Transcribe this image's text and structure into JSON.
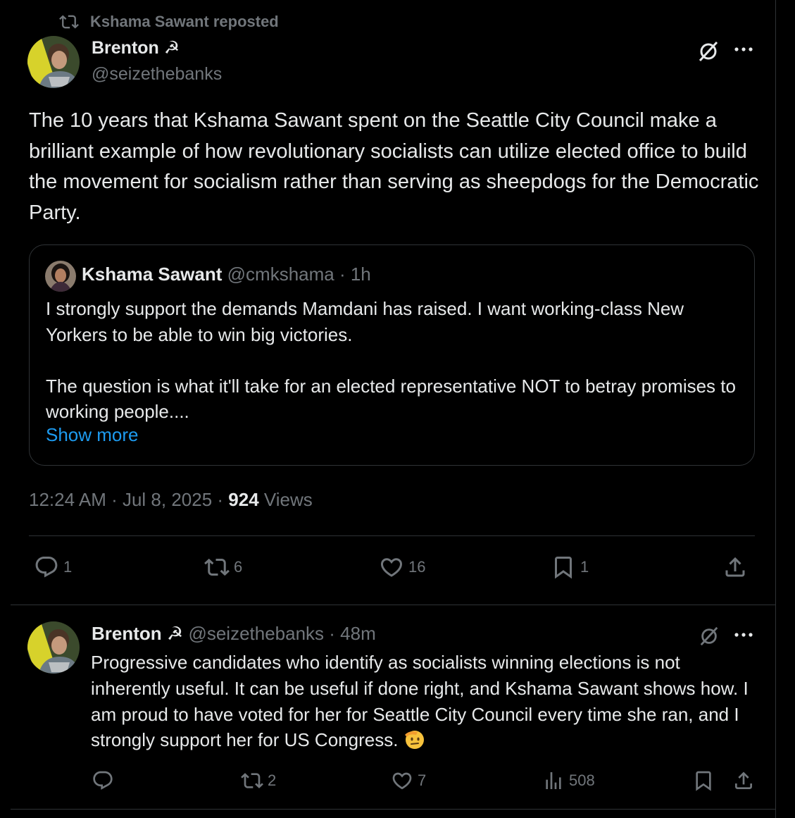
{
  "repost_banner": {
    "text": "Kshama Sawant reposted"
  },
  "main_post": {
    "author_name": "Brenton ☭",
    "author_handle": "@seizethebanks",
    "body": "The 10 years that Kshama Sawant spent on the Seattle City Council make a brilliant example of how revolutionary socialists can utilize elected office to build the movement for socialism rather than serving as sheepdogs for the Democratic Party.",
    "quote": {
      "author_name": "Kshama Sawant",
      "author_handle": "@cmkshama",
      "time": "· 1h",
      "para1": "I strongly support the demands Mamdani has raised. I want working-class New Yorkers to be able to win big victories.",
      "para2": "The question is what it'll take for an elected representative NOT to betray promises to working people....",
      "show_more": "Show more"
    },
    "timestamp": "12:24 AM · Jul 8, 2025 · ",
    "views_count": "924",
    "views_label": " Views",
    "actions": {
      "replies": "1",
      "reposts": "6",
      "likes": "16",
      "bookmarks": "1"
    }
  },
  "reply_post": {
    "author_name": "Brenton ☭",
    "author_handle": "@seizethebanks",
    "time": "· 48m",
    "body": "Progressive candidates who identify as socialists winning elections is not inherently useful. It can be useful if done right, and Kshama Sawant shows how. I am proud to have voted for her for Seattle City Council every time she ran, and I strongly support her for US Congress.",
    "actions": {
      "replies": "",
      "reposts": "2",
      "likes": "7",
      "views": "508"
    }
  },
  "colors": {
    "background": "#000000",
    "text": "#e7e9ea",
    "muted": "#71767b",
    "link": "#1d9bf0",
    "border": "#2f3336"
  }
}
